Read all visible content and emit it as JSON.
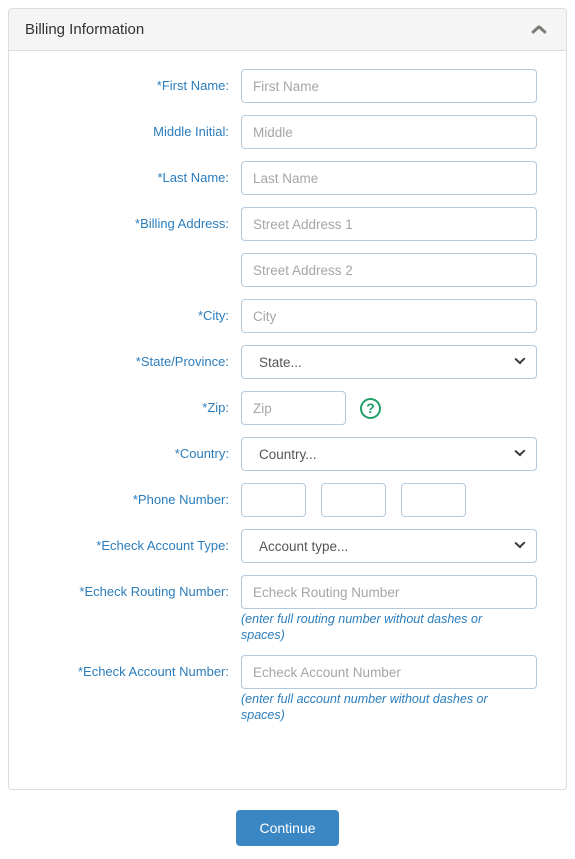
{
  "panel": {
    "title": "Billing Information",
    "collapse_icon": "chevron-up-icon"
  },
  "fields": {
    "first_name": {
      "label": "*First Name:",
      "placeholder": "First Name",
      "value": ""
    },
    "middle": {
      "label": "Middle Initial:",
      "placeholder": "Middle",
      "value": ""
    },
    "last_name": {
      "label": "*Last Name:",
      "placeholder": "Last Name",
      "value": ""
    },
    "address": {
      "label": "*Billing Address:",
      "placeholder1": "Street Address 1",
      "placeholder2": "Street Address 2",
      "value1": "",
      "value2": ""
    },
    "city": {
      "label": "*City:",
      "placeholder": "City",
      "value": ""
    },
    "state": {
      "label": "*State/Province:",
      "selected": "State...",
      "options": [
        "State..."
      ]
    },
    "zip": {
      "label": "*Zip:",
      "placeholder": "Zip",
      "value": "",
      "help_icon": "question-mark-icon"
    },
    "country": {
      "label": "*Country:",
      "selected": "Country...",
      "options": [
        "Country..."
      ]
    },
    "phone": {
      "label": "*Phone Number:",
      "part1": "",
      "part2": "",
      "part3": ""
    },
    "account_type": {
      "label": "*Echeck Account Type:",
      "selected": "Account type...",
      "options": [
        "Account type..."
      ]
    },
    "routing": {
      "label": "*Echeck Routing Number:",
      "placeholder": "Echeck Routing Number",
      "value": "",
      "hint": "(enter full routing number without dashes or spaces)"
    },
    "account": {
      "label": "*Echeck Account Number:",
      "placeholder": "Echeck Account Number",
      "value": "",
      "hint": "(enter full account number without dashes or spaces)"
    }
  },
  "footer": {
    "continue_label": "Continue"
  },
  "colors": {
    "label_blue": "#2b7dbc",
    "button_blue": "#3b87c4",
    "help_green": "#1fa06a",
    "input_border": "#b3cade"
  }
}
